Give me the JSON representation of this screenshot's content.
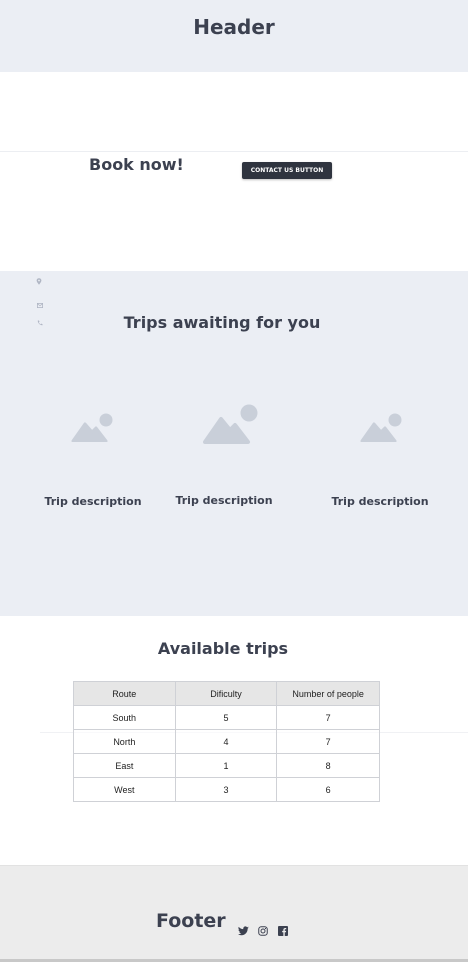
{
  "header": {
    "title": "Header"
  },
  "booking": {
    "title": "Book now!",
    "contact_button": "CONTACT US BUTTON"
  },
  "contact_icons": [
    "map-pin-icon",
    "mail-icon",
    "phone-icon"
  ],
  "trips": {
    "title": "Trips awaiting for you",
    "items": [
      {
        "image": "image-placeholder-icon",
        "description": "Trip description"
      },
      {
        "image": "image-placeholder-icon",
        "description": "Trip description"
      },
      {
        "image": "image-placeholder-icon",
        "description": "Trip description"
      }
    ]
  },
  "available": {
    "title": "Available trips",
    "columns": [
      "Route",
      "Dificulty",
      "Number of people"
    ],
    "rows": [
      [
        "South",
        "5",
        "7"
      ],
      [
        "North",
        "4",
        "7"
      ],
      [
        "East",
        "1",
        "8"
      ],
      [
        "West",
        "3",
        "6"
      ]
    ]
  },
  "footer": {
    "title": "Footer",
    "social": [
      "twitter-icon",
      "instagram-icon",
      "facebook-icon"
    ]
  },
  "colors": {
    "section_bg": "#ebeef4",
    "text_dark": "#3c4150",
    "button_bg": "#2f343f",
    "placeholder": "#c9cfd9",
    "footer_bg": "#ececec"
  }
}
